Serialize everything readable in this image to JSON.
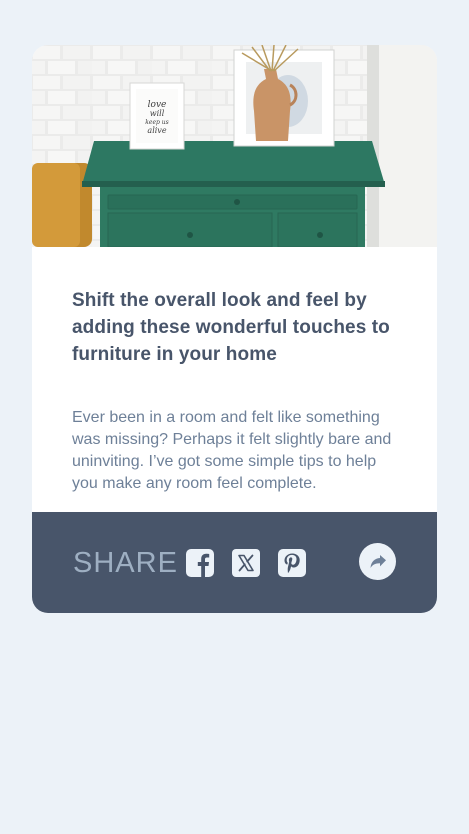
{
  "article": {
    "title": "Shift the overall look and feel by adding these wonderful touches to furniture in your home",
    "description": "Ever been in a room and felt like something was missing? Perhaps it felt slightly bare and uninviting. I’ve got some simple tips to help you make any room feel complete.",
    "hero_sign_text": [
      "love",
      "will",
      "keep us",
      "alive"
    ]
  },
  "share": {
    "label": "SHARE",
    "icons": [
      "facebook-icon",
      "x-icon",
      "pinterest-icon",
      "share-arrow-icon"
    ]
  },
  "colors": {
    "page_bg": "#ecf2f8",
    "card_bg": "#ffffff",
    "share_bar_bg": "#48556a",
    "title": "#48556a",
    "text": "#6e8098",
    "share_label": "#9eafc2",
    "dresser": "#2f7a62"
  }
}
